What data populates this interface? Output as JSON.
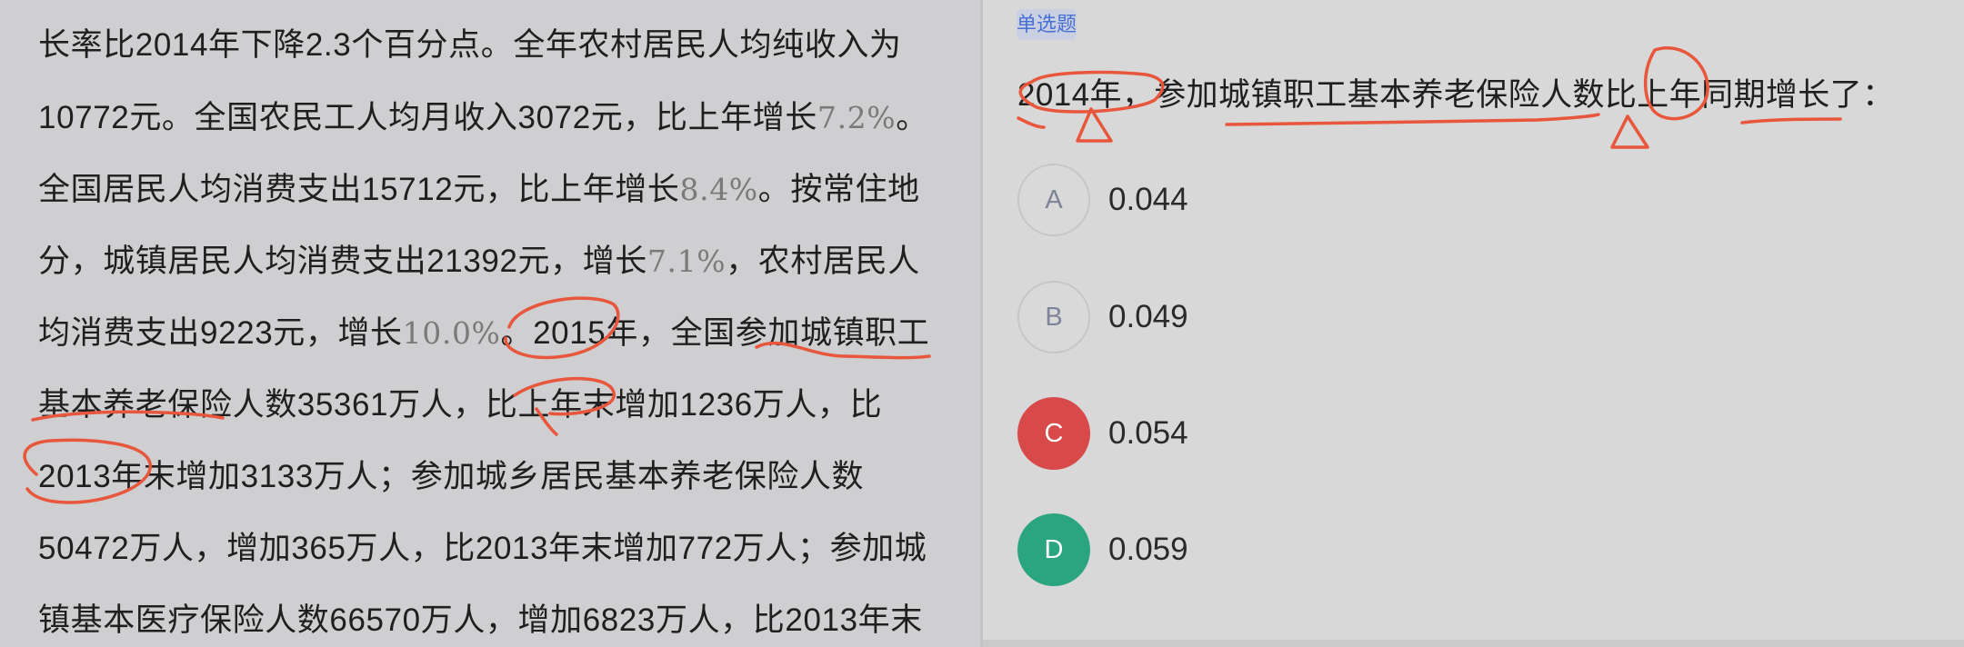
{
  "passage": {
    "lines": [
      [
        "长率比2014年下降2.3个百分点。全年农村居民人均纯收入为"
      ],
      [
        "10772元。全国农民工人均月收入3072元，比上年增长",
        "7.2%",
        "。"
      ],
      [
        "全国居民人均消费支出15712元，比上年增长",
        "8.4%",
        "。按常住地"
      ],
      [
        "分，城镇居民人均消费支出21392元，增长",
        "7.1%",
        "，农村居民人"
      ],
      [
        "均消费支出9223元，增长",
        "10.0%",
        "。2015年，全国参加城镇职工"
      ],
      [
        "基本养老保险人数35361万人，比上年末增加1236万人，比"
      ],
      [
        "2013年末增加3133万人；参加城乡居民基本养老保险人数"
      ],
      [
        "50472万人，增加365万人，比2013年末增加772万人；参加城"
      ],
      [
        "镇基本医疗保险人数66570万人，增加6823万人，比2013年末"
      ]
    ]
  },
  "question": {
    "type_label": "单选题",
    "text": "2014年，参加城镇职工基本养老保险人数比上年同期增长了："
  },
  "options": [
    {
      "letter": "A",
      "value": "0.044",
      "state": "normal"
    },
    {
      "letter": "B",
      "value": "0.049",
      "state": "normal"
    },
    {
      "letter": "C",
      "value": "0.054",
      "state": "wrong"
    },
    {
      "letter": "D",
      "value": "0.059",
      "state": "correct"
    }
  ],
  "colors": {
    "wrong": "#d8494a",
    "correct": "#2aa57f",
    "ink": "#e8563c",
    "badge_text": "#4a6fd4"
  }
}
